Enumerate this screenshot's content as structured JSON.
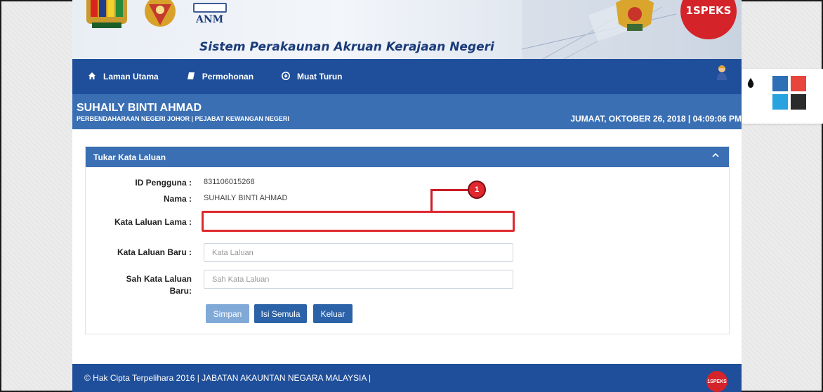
{
  "header": {
    "agency_abbr": "ANM",
    "system_title": "Sistem Perakaunan Akruan Kerajaan Negeri",
    "brand_logo_text": "1SPEKS"
  },
  "nav": {
    "items": [
      {
        "label": "Laman Utama",
        "icon": "home-icon"
      },
      {
        "label": "Permohonan",
        "icon": "book-icon"
      },
      {
        "label": "Muat Turun",
        "icon": "download-icon"
      }
    ],
    "user_icon": "user-icon"
  },
  "userbar": {
    "name": "SUHAILY BINTI AHMAD",
    "department": "PERBENDAHARAAN NEGERI JOHOR | PEJABAT KEWANGAN NEGERI",
    "datetime": "JUMAAT, OKTOBER 26, 2018 | 04:09:06 PM"
  },
  "panel": {
    "title": "Tukar Kata Laluan",
    "collapse_icon": "chevron-up-icon",
    "id_label": "ID Pengguna :",
    "id_value": "831106015268",
    "name_label": "Nama :",
    "name_value": "SUHAILY BINTI AHMAD",
    "old_pw_label": "Kata Laluan Lama :",
    "old_pw_value": "",
    "new_pw_label": "Kata Laluan Baru :",
    "new_pw_placeholder": "Kata Laluan",
    "confirm_pw_label_1": "Sah Kata Laluan",
    "confirm_pw_label_2": "Baru:",
    "confirm_pw_placeholder": "Sah Kata Laluan",
    "buttons": {
      "save": "Simpan",
      "reset": "Isi Semula",
      "exit": "Keluar"
    }
  },
  "annotation": {
    "number": "1"
  },
  "footer": {
    "copyright": "© Hak Cipta Terpelihara 2016 | JABATAN AKAUNTAN NEGARA MALAYSIA |",
    "logo_text": "1SPEKS"
  },
  "theme_switcher": {
    "icon": "droplet-icon",
    "colors": [
      "#2e6fb6",
      "#e8453c",
      "#29a3e0",
      "#2b2b2b"
    ]
  }
}
